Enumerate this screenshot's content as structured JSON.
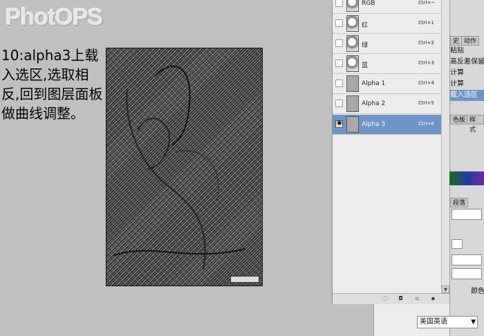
{
  "logo": {
    "text": "PhotOPS"
  },
  "instruction": "10:alpha3上载入选区,选取相反,回到图层面板做曲线调整。",
  "channels": {
    "items": [
      {
        "name": "RGB",
        "shortcut": "Ctrl+~",
        "visible": false,
        "thumb": "photo"
      },
      {
        "name": "红",
        "shortcut": "Ctrl+1",
        "visible": false,
        "thumb": "photo"
      },
      {
        "name": "绿",
        "shortcut": "Ctrl+2",
        "visible": false,
        "thumb": "photo"
      },
      {
        "name": "蓝",
        "shortcut": "Ctrl+3",
        "visible": false,
        "thumb": "photo"
      },
      {
        "name": "Alpha 1",
        "shortcut": "Ctrl+4",
        "visible": false,
        "thumb": "gray"
      },
      {
        "name": "Alpha 2",
        "shortcut": "Ctrl+5",
        "visible": false,
        "thumb": "gray"
      },
      {
        "name": "Alpha 3",
        "shortcut": "Ctrl+6",
        "visible": true,
        "thumb": "gray",
        "selected": true
      }
    ],
    "footer_icons": [
      "dotted-circle-icon",
      "load-selection-icon",
      "new-channel-icon",
      "delete-channel-icon"
    ]
  },
  "side_panel": {
    "tabs": [
      "史",
      "动作"
    ],
    "history": [
      "粘贴",
      "高反差保留",
      "计算",
      "计算",
      "载入选区"
    ],
    "tabs2": [
      "色板",
      "样式"
    ],
    "tabs3": [
      "段落"
    ],
    "labels": [
      "颜色"
    ]
  },
  "language_select": {
    "value": "美国英语"
  },
  "colors": {
    "selection": "#6f95c6",
    "panel": "#ececec",
    "background": "#c0c0c0"
  }
}
